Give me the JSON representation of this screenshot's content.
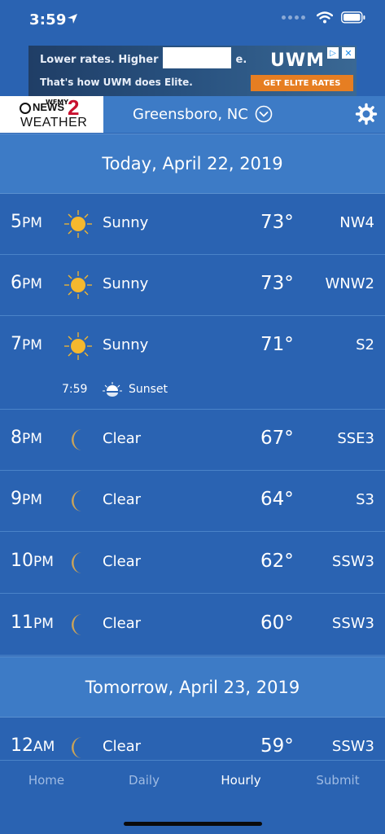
{
  "status_bar": {
    "time": "3:59"
  },
  "ad": {
    "line1": "Lower rates. Higher l",
    "line1_end": "e.",
    "line2": "That's how UWM does Elite.",
    "logo": "UWM",
    "cta": "GET ELITE RATES"
  },
  "header": {
    "brand_top": "WFMY",
    "brand_news": "NEWS",
    "brand_two": "2",
    "brand_weather": "WEATHER",
    "location": "Greensboro, NC"
  },
  "days": [
    {
      "title": "Today, April 22, 2019"
    },
    {
      "title": "Tomorrow, April 23, 2019"
    }
  ],
  "hours": [
    {
      "hour": "5",
      "ampm": "PM",
      "icon": "sun-icon",
      "condition": "Sunny",
      "temp": "73°",
      "wind": "NW4"
    },
    {
      "hour": "6",
      "ampm": "PM",
      "icon": "sun-icon",
      "condition": "Sunny",
      "temp": "73°",
      "wind": "WNW2"
    },
    {
      "hour": "7",
      "ampm": "PM",
      "icon": "sun-icon",
      "condition": "Sunny",
      "temp": "71°",
      "wind": "S2",
      "event": {
        "time": "7:59",
        "icon": "sunset-icon",
        "label": "Sunset"
      }
    },
    {
      "hour": "8",
      "ampm": "PM",
      "icon": "moon-icon",
      "condition": "Clear",
      "temp": "67°",
      "wind": "SSE3"
    },
    {
      "hour": "9",
      "ampm": "PM",
      "icon": "moon-icon",
      "condition": "Clear",
      "temp": "64°",
      "wind": "S3"
    },
    {
      "hour": "10",
      "ampm": "PM",
      "icon": "moon-icon",
      "condition": "Clear",
      "temp": "62°",
      "wind": "SSW3"
    },
    {
      "hour": "11",
      "ampm": "PM",
      "icon": "moon-icon",
      "condition": "Clear",
      "temp": "60°",
      "wind": "SSW3"
    },
    {
      "hour": "12",
      "ampm": "AM",
      "icon": "moon-icon",
      "condition": "Clear",
      "temp": "59°",
      "wind": "SSW3"
    }
  ],
  "tabs": [
    {
      "label": "Home",
      "active": false
    },
    {
      "label": "Daily",
      "active": false
    },
    {
      "label": "Hourly",
      "active": true
    },
    {
      "label": "Submit",
      "active": false
    }
  ],
  "colors": {
    "background": "#2a63b2",
    "header": "#3d7bc6",
    "sun": "#f5b82e",
    "moon": "#c9a35a",
    "inactive_tab": "#9fbbe3"
  }
}
